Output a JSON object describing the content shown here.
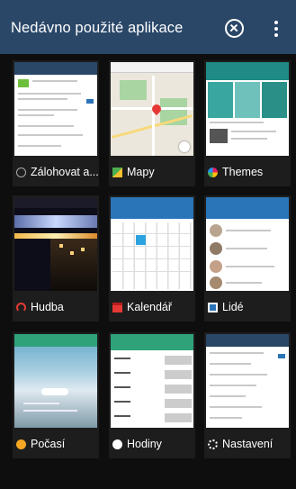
{
  "header": {
    "title": "Nedávno použité aplikace",
    "close_all_icon": "close-all-icon",
    "overflow_icon": "overflow-menu-icon"
  },
  "apps": [
    {
      "label": "Zálohovat a...",
      "icon": "backup-icon",
      "accent": "#ffffff"
    },
    {
      "label": "Mapy",
      "icon": "maps-icon",
      "accent": "#4caf50"
    },
    {
      "label": "Themes",
      "icon": "themes-icon",
      "accent": "#e91e63"
    },
    {
      "label": "Hudba",
      "icon": "headphones-icon",
      "accent": "#e53935"
    },
    {
      "label": "Kalendář",
      "icon": "calendar-icon",
      "accent": "#e53935"
    },
    {
      "label": "Lidé",
      "icon": "contacts-icon",
      "accent": "#2a74b8"
    },
    {
      "label": "Počasí",
      "icon": "weather-icon",
      "accent": "#f5a623"
    },
    {
      "label": "Hodiny",
      "icon": "clock-icon",
      "accent": "#ffffff"
    },
    {
      "label": "Nastavení",
      "icon": "gear-icon",
      "accent": "#ffffff"
    }
  ]
}
